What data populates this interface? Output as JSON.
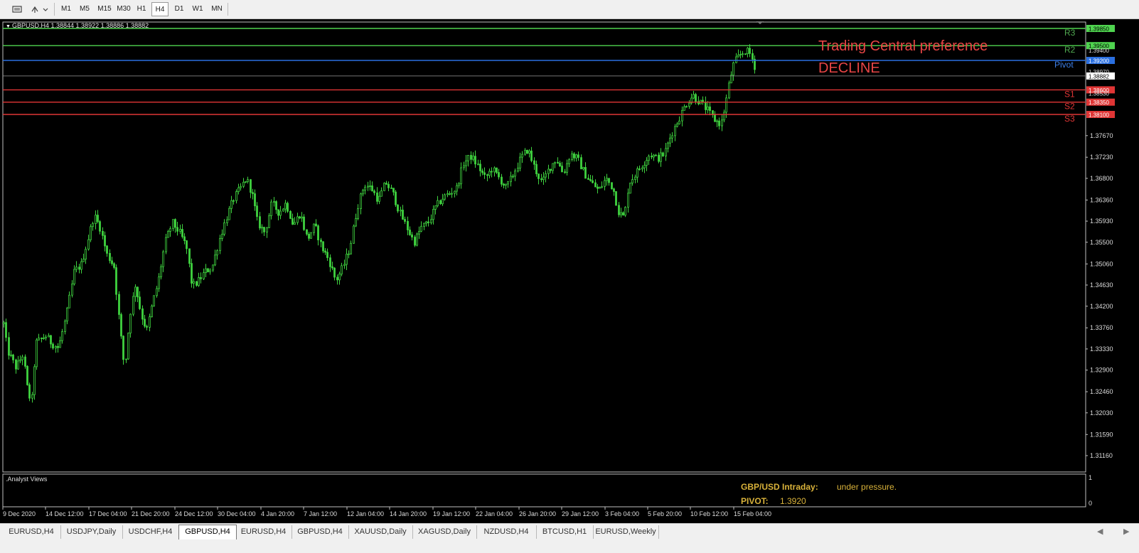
{
  "toolbar": {
    "timeframes": [
      "M1",
      "M5",
      "M15",
      "M30",
      "H1",
      "H4",
      "D1",
      "W1",
      "MN"
    ],
    "active_timeframe": "H4"
  },
  "chart": {
    "header": "GBPUSD,H4  1.38844 1.38922 1.38886 1.38882",
    "symbol": "GBPUSD",
    "timeframe": "H4",
    "ohlc": {
      "open": 1.38844,
      "high": 1.38922,
      "low": 1.38886,
      "close": 1.38882
    },
    "current_price_label": "1.38882",
    "ymin": 1.3116,
    "ymax": 1.3985,
    "price_axis": [
      "1.37670",
      "1.37230",
      "1.36800",
      "1.36360",
      "1.35930",
      "1.35500",
      "1.35060",
      "1.34630",
      "1.34200",
      "1.33760",
      "1.33330",
      "1.32900",
      "1.32460",
      "1.32030",
      "1.31590",
      "1.31160"
    ],
    "price_axis_upper": [
      "1.39400",
      "1.38970",
      "1.38530"
    ],
    "time_axis": [
      "9 Dec 2020",
      "14 Dec 12:00",
      "17 Dec 04:00",
      "21 Dec 20:00",
      "24 Dec 12:00",
      "30 Dec 04:00",
      "4 Jan 20:00",
      "7 Jan 12:00",
      "12 Jan 04:00",
      "14 Jan 20:00",
      "19 Jan 12:00",
      "22 Jan 04:00",
      "26 Jan 20:00",
      "29 Jan 12:00",
      "3 Feb 04:00",
      "5 Feb 20:00",
      "10 Feb 12:00",
      "15 Feb 04:00"
    ],
    "levels": [
      {
        "name": "R3",
        "price": 1.3985,
        "label": "1.39850",
        "color": "#4fd44f",
        "text_color": "#4fa84f"
      },
      {
        "name": "R2",
        "price": 1.395,
        "label": "1.39500",
        "color": "#4fd44f",
        "text_color": "#4fa84f"
      },
      {
        "name": "Pivot",
        "price": 1.392,
        "label": "1.39200",
        "color": "#2a6fe0",
        "text_color": "#3d7fe8"
      },
      {
        "name": "S1",
        "price": 1.386,
        "label": "1.38600",
        "color": "#e03535",
        "text_color": "#e03535"
      },
      {
        "name": "S2",
        "price": 1.3835,
        "label": "1.38350",
        "color": "#e03535",
        "text_color": "#e03535"
      },
      {
        "name": "S3",
        "price": 1.381,
        "label": "1.38100",
        "color": "#e03535",
        "text_color": "#e03535"
      }
    ],
    "annotation": {
      "line1": "Trading Central preference",
      "line2": "DECLINE",
      "color": "#e84545"
    },
    "candle_color": "#3fd23f"
  },
  "analyst_panel": {
    "title": ".Analyst Views",
    "axis_top": "1",
    "axis_bottom": "0",
    "intraday_label": "GBP/USD Intraday:",
    "intraday_value": "under pressure.",
    "pivot_label": "PIVOT:",
    "pivot_value": "1.3920",
    "text_color": "#d9b23a"
  },
  "tabs": [
    "EURUSD,H4",
    "USDJPY,Daily",
    "USDCHF,H4",
    "GBPUSD,H4",
    "EURUSD,H4",
    "GBPUSD,H4",
    "XAUUSD,Daily",
    "XAGUSD,Daily",
    "NZDUSD,H4",
    "BTCUSD,H1",
    "EURUSD,Weekly"
  ],
  "active_tab": "GBPUSD,H4"
}
